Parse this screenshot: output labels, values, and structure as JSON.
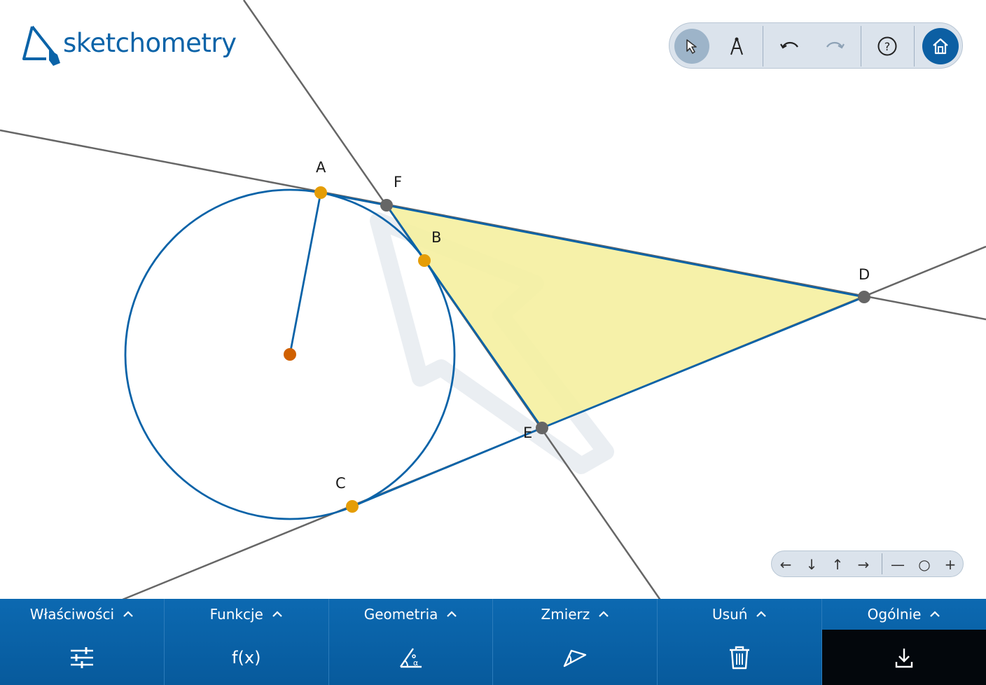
{
  "app": {
    "logo_text": "sketchometry"
  },
  "toolbar": {
    "buttons": [
      {
        "icon": "pointer-arrow-icon",
        "state": "active"
      },
      {
        "icon": "compass-icon",
        "state": "normal"
      },
      {
        "icon": "undo-icon",
        "state": "normal"
      },
      {
        "icon": "redo-icon",
        "state": "disabled"
      },
      {
        "icon": "help-icon",
        "state": "normal"
      },
      {
        "icon": "home-icon",
        "state": "highlighted"
      }
    ]
  },
  "geometry": {
    "points": {
      "A": {
        "label": "A",
        "color": "#e59d06"
      },
      "B": {
        "label": "B",
        "color": "#e59d06"
      },
      "C": {
        "label": "C",
        "color": "#e59d06"
      },
      "D": {
        "label": "D",
        "color": "#666666"
      },
      "E": {
        "label": "E",
        "color": "#666666"
      },
      "F": {
        "label": "F",
        "color": "#666666"
      },
      "center": {
        "label": "",
        "color": "#d06000"
      }
    },
    "triangle_fill": "#f5f0a0",
    "segment_color": "#0a63a8",
    "line_color": "#666666"
  },
  "nav": {
    "left": "←",
    "down": "↓",
    "up": "↑",
    "right": "→",
    "zoom_out": "—",
    "zoom_reset": "○",
    "zoom_in": "+"
  },
  "bottombar": {
    "sections": [
      {
        "label": "Właściwości",
        "icon": "sliders-icon"
      },
      {
        "label": "Funkcje",
        "icon": "fx-icon",
        "icon_text": "f(x)"
      },
      {
        "label": "Geometria",
        "icon": "angle-alpha-icon"
      },
      {
        "label": "Zmierz",
        "icon": "measure-angle-icon"
      },
      {
        "label": "Usuń",
        "icon": "trash-icon"
      },
      {
        "label": "Ogólnie",
        "icon": "download-icon"
      }
    ]
  }
}
